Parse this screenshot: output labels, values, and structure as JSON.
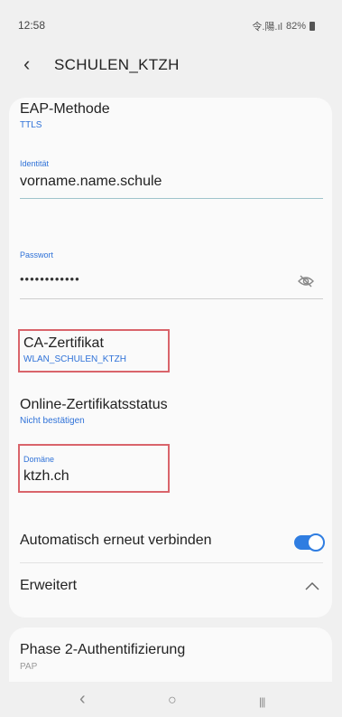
{
  "status_bar": {
    "time": "12:58",
    "signal": "令.陽.ıl",
    "battery": "82%"
  },
  "header": {
    "title": "SCHULEN_KTZH"
  },
  "eap": {
    "label": "EAP-Methode",
    "value": "TTLS"
  },
  "identity": {
    "label": "Identität",
    "value": "vorname.name.schule"
  },
  "password": {
    "label": "Passwort",
    "value": "••••••••••••"
  },
  "ca_cert": {
    "label": "CA-Zertifikat",
    "value": "WLAN_SCHULEN_KTZH"
  },
  "online_cert": {
    "label": "Online-Zertifikatsstatus",
    "value": "Nicht bestätigen"
  },
  "domain": {
    "label": "Domäne",
    "value": "ktzh.ch"
  },
  "auto_reconnect": {
    "label": "Automatisch erneut verbinden",
    "enabled": true
  },
  "advanced": {
    "label": "Erweitert"
  },
  "phase2": {
    "label": "Phase 2-Authentifizierung",
    "value": "PAP"
  },
  "nav": {
    "back": "‹",
    "home": "○",
    "recents": "|||"
  },
  "colors": {
    "accent": "#2f72d8",
    "highlight_box": "#d9646b",
    "toggle": "#2f7de1"
  }
}
